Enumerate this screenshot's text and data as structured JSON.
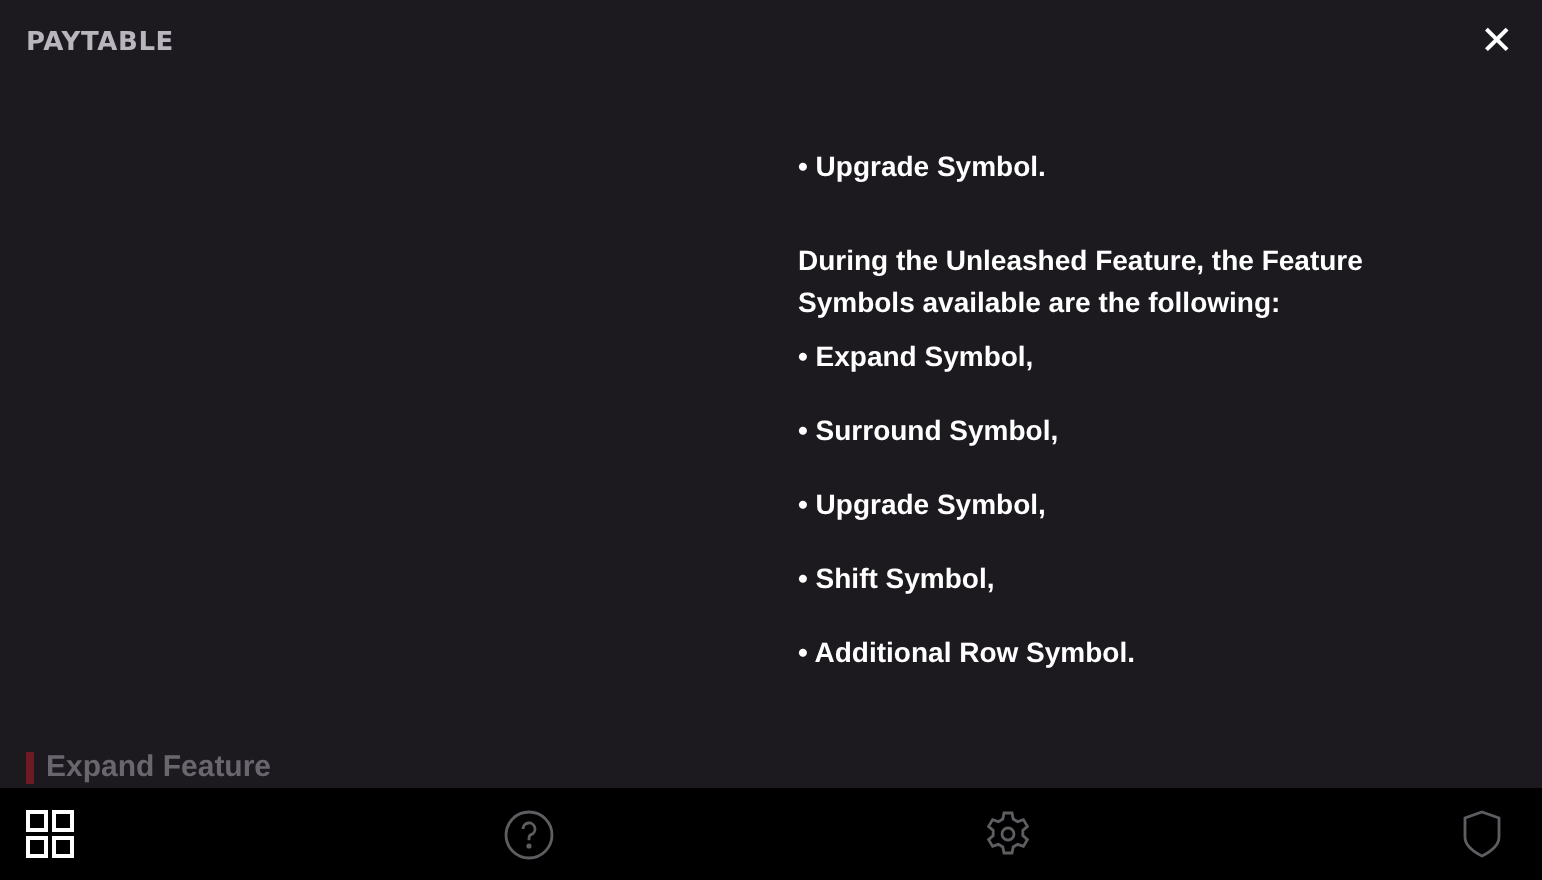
{
  "header": {
    "title": "PAYTABLE",
    "close": "✕"
  },
  "section_heading": "Expand Feature",
  "content": [
    {
      "kind": "bullet",
      "text": "• Upgrade Symbol."
    },
    {
      "kind": "paragraph",
      "text": "During the Unleashed Feature, the Feature Symbols available are the following:"
    },
    {
      "kind": "bullet",
      "text": "• Expand Symbol,"
    },
    {
      "kind": "bullet",
      "text": "• Surround Symbol,"
    },
    {
      "kind": "bullet",
      "text": "• Upgrade Symbol,"
    },
    {
      "kind": "bullet",
      "text": "• Shift Symbol,"
    },
    {
      "kind": "bullet",
      "text": "• Additional Row Symbol."
    }
  ],
  "bottom_nav": [
    {
      "kind": "paytable",
      "selected": true
    },
    {
      "kind": "help",
      "selected": false
    },
    {
      "kind": "settings",
      "selected": false
    },
    {
      "kind": "shield",
      "selected": false
    }
  ]
}
